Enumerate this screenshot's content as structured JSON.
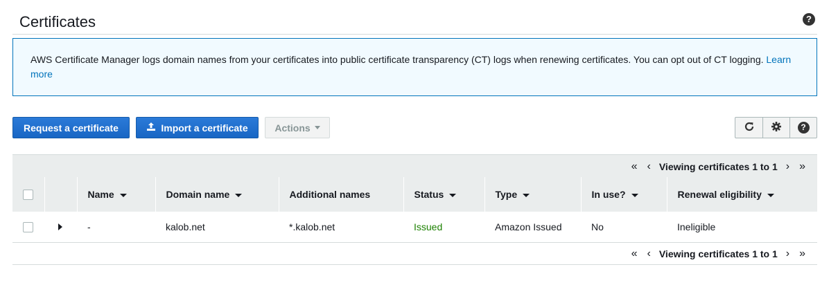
{
  "header": {
    "title": "Certificates",
    "help_icon": "question-circle-icon",
    "help_glyph": "?"
  },
  "info": {
    "text": "AWS Certificate Manager logs domain names from your certificates into public certificate transparency (CT) logs when renewing certificates. You can opt out of CT logging. ",
    "link": "Learn more"
  },
  "toolbar": {
    "request_label": "Request a certificate",
    "import_label": "Import a certificate",
    "actions_label": "Actions",
    "refresh_icon": "refresh-icon",
    "settings_icon": "gear-icon",
    "help_icon": "question-circle-icon",
    "refresh_glyph": "⟳",
    "settings_glyph": "⚙",
    "help_glyph": "?"
  },
  "pager": {
    "text": "Viewing certificates 1 to 1",
    "first": "«",
    "prev": "‹",
    "next": "›",
    "last": "»"
  },
  "table": {
    "columns": [
      "Name",
      "Domain name",
      "Additional names",
      "Status",
      "Type",
      "In use?",
      "Renewal eligibility"
    ],
    "rows": [
      {
        "name": "-",
        "domain": "kalob.net",
        "additional": "*.kalob.net",
        "status": "Issued",
        "type": "Amazon Issued",
        "in_use": "No",
        "renewal": "Ineligible"
      }
    ]
  },
  "colors": {
    "primary": "#1f6fd1",
    "link": "#0073bb",
    "issued": "#1d8102",
    "info_bg": "#f1faff"
  }
}
